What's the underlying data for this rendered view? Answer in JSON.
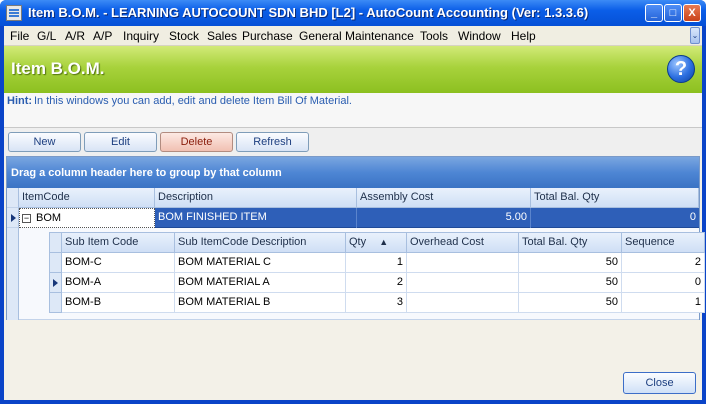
{
  "window": {
    "title": "Item B.O.M. - LEARNING AUTOCOUNT SDN BHD [L2] - AutoCount Accounting (Ver: 1.3.3.6)",
    "min_glyph": "_",
    "max_glyph": "□",
    "close_glyph": "X"
  },
  "menu": {
    "items": [
      "File",
      "G/L",
      "A/R",
      "A/P",
      "Inquiry",
      "Stock",
      "Sales",
      "Purchase",
      "General Maintenance",
      "Tools",
      "Window",
      "Help"
    ],
    "scroll_glyph": "⌄"
  },
  "header": {
    "title": "Item B.O.M.",
    "help_glyph": "?",
    "band_color": "#a8d23c"
  },
  "hint": {
    "label": "Hint:",
    "text": "In this windows you can add, edit and delete Item Bill Of Material."
  },
  "toolbar": {
    "new_label": "New",
    "edit_label": "Edit",
    "delete_label": "Delete",
    "refresh_label": "Refresh"
  },
  "grid": {
    "group_panel_text": "Drag a column header here to group by that column",
    "columns": [
      "ItemCode",
      "Description",
      "Assembly Cost",
      "Total Bal. Qty"
    ],
    "master_row": {
      "expander_glyph": "−",
      "item_code": "BOM",
      "description": "BOM FINISHED ITEM",
      "assembly_cost": "5.00",
      "total_bal_qty": "0"
    },
    "detail": {
      "columns": [
        "Sub Item Code",
        "Sub ItemCode Description",
        "Qty",
        "Overhead Cost",
        "Total Bal. Qty",
        "Sequence"
      ],
      "sort_indicator": "▲",
      "rows": [
        {
          "sub_item_code": "BOM-C",
          "description": "BOM MATERIAL C",
          "qty": "1",
          "overhead_cost": "",
          "total_bal_qty": "50",
          "sequence": "2"
        },
        {
          "sub_item_code": "BOM-A",
          "description": "BOM MATERIAL A",
          "qty": "2",
          "overhead_cost": "",
          "total_bal_qty": "50",
          "sequence": "0"
        },
        {
          "sub_item_code": "BOM-B",
          "description": "BOM MATERIAL B",
          "qty": "3",
          "overhead_cost": "",
          "total_bal_qty": "50",
          "sequence": "1"
        }
      ]
    }
  },
  "footer": {
    "close_label": "Close"
  }
}
